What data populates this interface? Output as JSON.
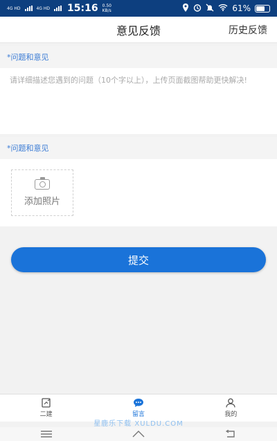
{
  "status": {
    "signal1": "4G HD",
    "signal2": "4G HD",
    "time": "15:16",
    "speed_value": "0.50",
    "speed_unit": "KB/s",
    "battery": "61%"
  },
  "header": {
    "title": "意见反馈",
    "history": "历史反馈"
  },
  "form": {
    "section1_label": "*问题和意见",
    "placeholder": "请详细描述您遇到的问题（10个字以上），上传页面截图帮助更快解决!",
    "section2_label": "*问题和意见",
    "add_photo": "添加照片",
    "submit": "提交"
  },
  "tabs": [
    {
      "label": "二建",
      "icon": "book-icon"
    },
    {
      "label": "留言",
      "icon": "chat-icon"
    },
    {
      "label": "我的",
      "icon": "user-icon"
    }
  ],
  "active_tab": "留言",
  "watermark": "星鹿乐下载 XULDU.COM",
  "colors": {
    "status_bar": "#0d3f7f",
    "accent": "#1a73d9",
    "section_label": "#3a7bd5"
  }
}
